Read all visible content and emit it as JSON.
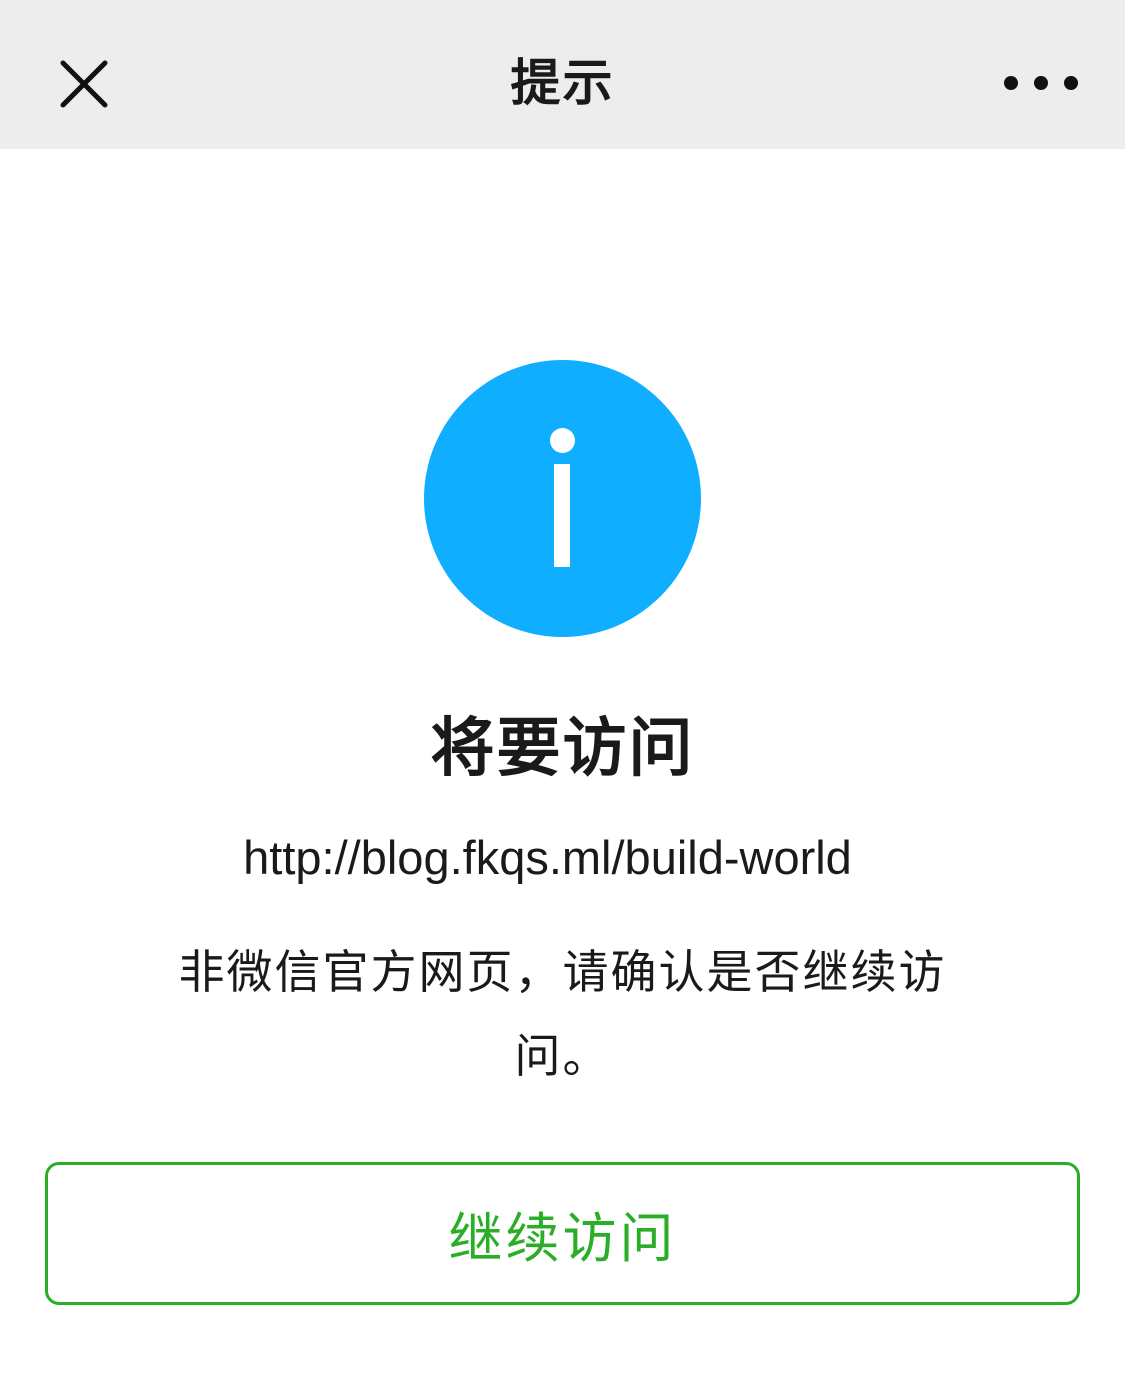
{
  "nav": {
    "title": "提示",
    "close_icon": "close-icon",
    "more_icon": "more-icon"
  },
  "message": {
    "icon": "info-icon",
    "icon_color": "#10aeff",
    "title": "将要访问",
    "url": "http://blog.fkqs.ml/build-world",
    "description": "非微信官方网页，请确认是否继续访问。"
  },
  "actions": {
    "continue_label": "继续访问",
    "accent_color": "#2aae27"
  }
}
